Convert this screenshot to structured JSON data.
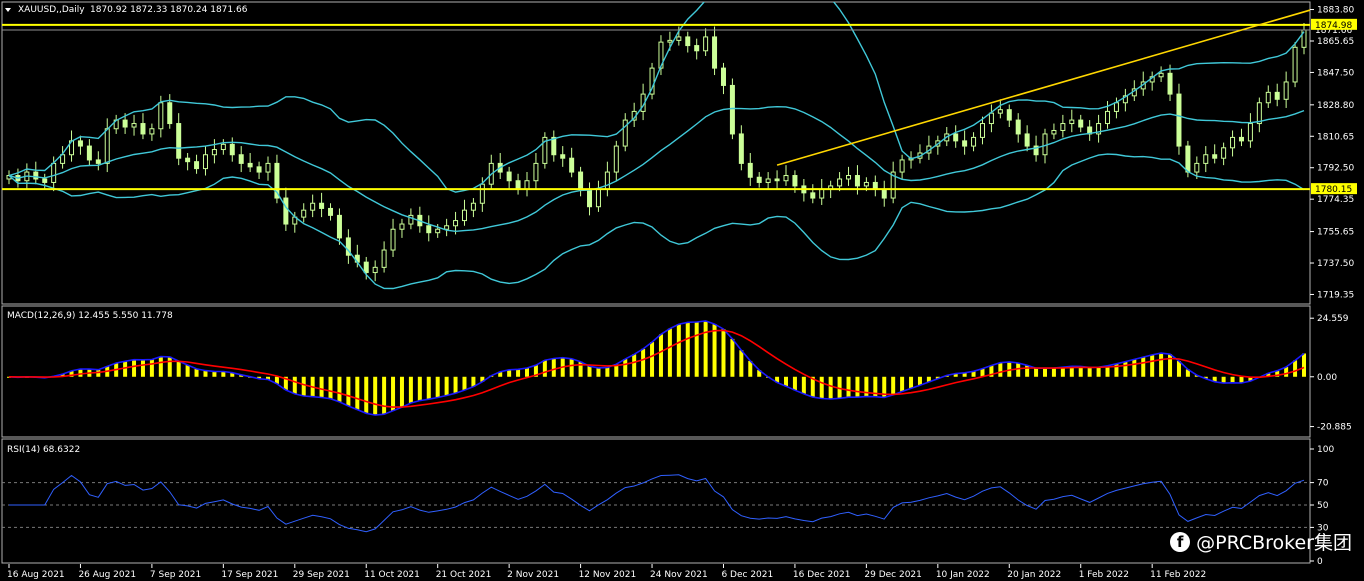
{
  "header": {
    "symbol": "XAUUSD,,Daily",
    "ohlc": "1870.92 1872.33 1870.24 1871.66",
    "macd_label": "MACD(12,26,9) 12.455 5.550 11.778",
    "rsi_label": "RSI(14) 68.6322"
  },
  "watermark": {
    "text": "@PRCBroker集团",
    "icon": "facebook-icon"
  },
  "colors": {
    "background": "#000000",
    "candle": "#ccff99",
    "bollinger": "#40c8d8",
    "trendline": "#ffd700",
    "level_line": "#ffff00",
    "macd_hist": "#ffff00",
    "macd_line": "#1a1aff",
    "signal_line": "#ff0000",
    "rsi_line": "#3060ff",
    "grid": "#7a7a7a"
  },
  "chart_data": [
    {
      "type": "candlestick",
      "panel": "price",
      "price_ticks": [
        "1883.80",
        "1865.65",
        "1847.50",
        "1828.80",
        "1810.65",
        "1792.50",
        "1774.35",
        "1755.65",
        "1737.50",
        "1719.35"
      ],
      "ylim": [
        1715,
        1887
      ],
      "date_labels": [
        "16 Aug 2021",
        "26 Aug 2021",
        "7 Sep 2021",
        "17 Sep 2021",
        "29 Sep 2021",
        "11 Oct 2021",
        "21 Oct 2021",
        "2 Nov 2021",
        "12 Nov 2021",
        "24 Nov 2021",
        "6 Dec 2021",
        "16 Dec 2021",
        "29 Dec 2021",
        "10 Jan 2022",
        "20 Jan 2022",
        "1 Feb 2022",
        "11 Feb 2022"
      ],
      "date_label_index": [
        0,
        8,
        16,
        24,
        32,
        40,
        48,
        56,
        64,
        72,
        80,
        88,
        96,
        104,
        112,
        120,
        128
      ],
      "close": [
        1788,
        1785,
        1790,
        1786,
        1784,
        1795,
        1800,
        1808,
        1805,
        1797,
        1795,
        1815,
        1820,
        1816,
        1818,
        1812,
        1815,
        1830,
        1818,
        1798,
        1796,
        1792,
        1800,
        1803,
        1806,
        1800,
        1795,
        1793,
        1790,
        1795,
        1775,
        1760,
        1764,
        1768,
        1772,
        1769,
        1765,
        1752,
        1742,
        1738,
        1732,
        1735,
        1745,
        1757,
        1760,
        1765,
        1759,
        1755,
        1757,
        1759,
        1762,
        1768,
        1772,
        1783,
        1795,
        1790,
        1785,
        1780,
        1785,
        1795,
        1810,
        1800,
        1798,
        1790,
        1780,
        1770,
        1780,
        1790,
        1805,
        1820,
        1825,
        1835,
        1850,
        1865,
        1866,
        1868,
        1863,
        1860,
        1868,
        1850,
        1840,
        1812,
        1795,
        1787,
        1784,
        1786,
        1785,
        1788,
        1782,
        1778,
        1775,
        1780,
        1782,
        1786,
        1788,
        1782,
        1784,
        1780,
        1775,
        1790,
        1797,
        1798,
        1801,
        1805,
        1808,
        1812,
        1808,
        1805,
        1810,
        1818,
        1824,
        1826,
        1820,
        1812,
        1805,
        1800,
        1812,
        1814,
        1818,
        1820,
        1816,
        1812,
        1818,
        1825,
        1830,
        1834,
        1838,
        1842,
        1845,
        1847,
        1835,
        1805,
        1790,
        1795,
        1800,
        1798,
        1804,
        1810,
        1808,
        1818,
        1830,
        1836,
        1832,
        1842,
        1862,
        1872
      ],
      "high_level": 1874.98,
      "low_level": 1780.15,
      "current_price_label": "1871.66",
      "high_level_label": "1874.98",
      "low_level_label": "1780.15",
      "trendline": {
        "from": {
          "index": 86,
          "price": 1794
        },
        "to": {
          "index": 146,
          "price": 1886
        }
      },
      "bollinger_period": 20,
      "bollinger_mult": 2
    },
    {
      "type": "macd",
      "panel": "macd",
      "label": "MACD(12,26,9) 12.455 5.550 11.778",
      "ticks": [
        "24.559",
        "0.00",
        "-20.885"
      ],
      "ylim": [
        -24,
        28
      ]
    },
    {
      "type": "line",
      "panel": "rsi",
      "label": "RSI(14) 68.6322",
      "ticks": [
        "100",
        "70",
        "50",
        "30",
        "0"
      ],
      "levels": [
        70,
        50,
        30
      ],
      "ylim": [
        0,
        100
      ]
    }
  ]
}
